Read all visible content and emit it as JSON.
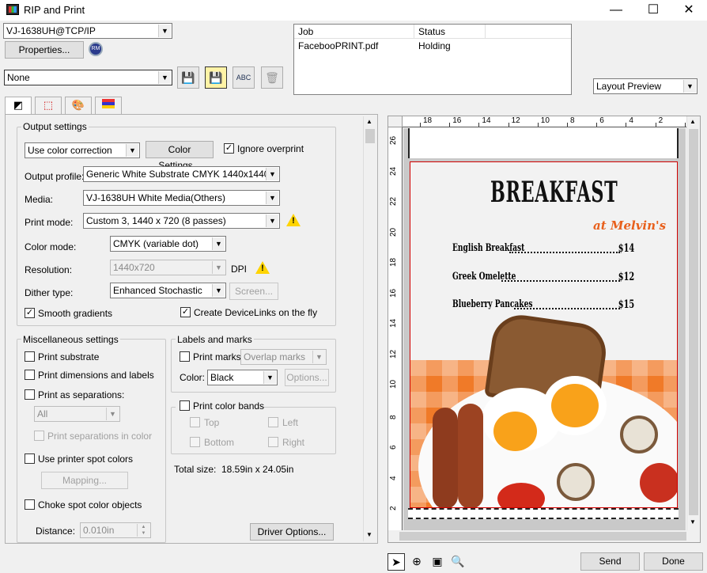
{
  "window": {
    "title": "RIP and Print",
    "minimize": "—",
    "maximize": "☐",
    "close": "✕"
  },
  "printer": {
    "selected": "VJ-1638UH@TCP/IP",
    "properties_label": "Properties..."
  },
  "preset": {
    "selected": "None"
  },
  "jobs": {
    "columns": [
      "Job",
      "Status"
    ],
    "rows": [
      {
        "job": "FaceboοPRINT.pdf",
        "status": "Holding"
      }
    ]
  },
  "preview_mode": {
    "selected": "Layout Preview"
  },
  "output_settings": {
    "group_label": "Output settings",
    "color_correction": "Use color correction",
    "color_settings_label": "Color Settings...",
    "ignore_overprint_label": "Ignore overprint",
    "ignore_overprint_checked": true,
    "output_profile_label": "Output profile:",
    "output_profile": "Generic White Substrate CMYK 1440x1440.icc",
    "media_label": "Media:",
    "media": "VJ-1638UH White Media(Others)",
    "print_mode_label": "Print mode:",
    "print_mode": "Custom 3, 1440 x 720 (8 passes)",
    "color_mode_label": "Color mode:",
    "color_mode": "CMYK (variable dot)",
    "resolution_label": "Resolution:",
    "resolution": "1440x720",
    "dpi_label": "DPI",
    "dither_label": "Dither type:",
    "dither": "Enhanced Stochastic",
    "screen_label": "Screen...",
    "smooth_gradients_label": "Smooth gradients",
    "smooth_gradients_checked": true,
    "devicelinks_label": "Create DeviceLinks on the fly",
    "devicelinks_checked": true
  },
  "misc": {
    "group_label": "Miscellaneous settings",
    "print_substrate": "Print substrate",
    "print_dimensions": "Print dimensions and labels",
    "print_separations": "Print as separations:",
    "separations_value": "All",
    "print_separations_in_color": "Print separations in color",
    "use_spot_colors": "Use printer spot colors",
    "mapping_label": "Mapping...",
    "choke_spot": "Choke spot color objects",
    "distance_label": "Distance:",
    "distance_value": "0.010in"
  },
  "labels_marks": {
    "group_label": "Labels and marks",
    "print_marks": "Print marks:",
    "marks_value": "Overlap marks",
    "color_label": "Color:",
    "color_value": "Black",
    "options_label": "Options..."
  },
  "color_bands": {
    "label": "Print color bands",
    "top": "Top",
    "left": "Left",
    "bottom": "Bottom",
    "right": "Right"
  },
  "total_size": {
    "label": "Total size:",
    "value": "18.59in x 24.05in"
  },
  "driver_options_label": "Driver Options...",
  "ruler": {
    "h_ticks": [
      "18",
      "16",
      "14",
      "12",
      "10",
      "8",
      "6",
      "4",
      "2",
      "0"
    ],
    "v_ticks": [
      "26",
      "24",
      "22",
      "20",
      "18",
      "16",
      "14",
      "12",
      "10",
      "8",
      "6",
      "4",
      "2"
    ]
  },
  "menu": {
    "title": "BREAKFAST",
    "subtitle": "at Melvin's",
    "items": [
      {
        "name": "English Breakfast",
        "price": "$14"
      },
      {
        "name": "Greek Omelette",
        "price": "$12"
      },
      {
        "name": "Blueberry Pancakes",
        "price": "$15"
      }
    ]
  },
  "bottom": {
    "send_label": "Send",
    "done_label": "Done"
  },
  "colors": {
    "accent": "#0078d7",
    "menu_orange": "#e8601c",
    "page_border": "#d00000"
  }
}
